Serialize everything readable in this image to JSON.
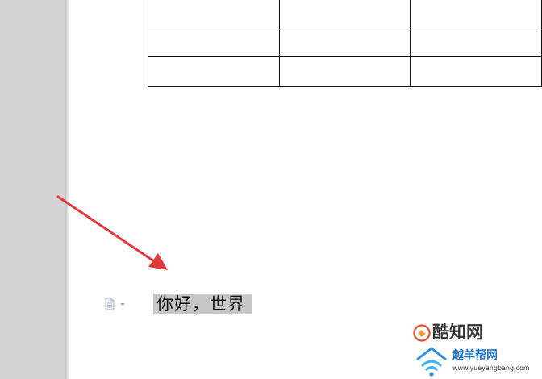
{
  "document": {
    "table": {
      "rows": [
        [
          "",
          "",
          ""
        ],
        [
          "",
          "",
          ""
        ],
        [
          "",
          "",
          ""
        ]
      ]
    },
    "paragraph_text": "你好，世界"
  },
  "colors": {
    "selection_highlight": "#c6c6c6",
    "annotation_arrow": "#e03a3a",
    "gray_margin": "#d4d4d4"
  },
  "icons": {
    "paragraph_marker": "document-icon",
    "paragraph_dropdown": "caret-down-icon",
    "annotation": "red-arrow-icon"
  },
  "watermarks": [
    {
      "text": "酷知网"
    },
    {
      "text": "越羊帮网",
      "url": "www.yueyangbang.com"
    }
  ]
}
